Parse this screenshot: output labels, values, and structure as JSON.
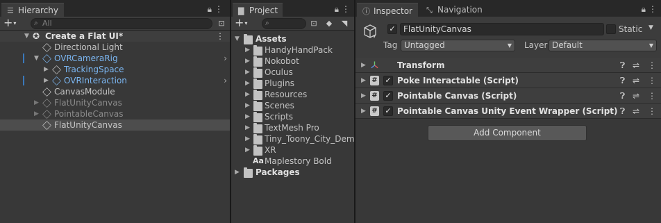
{
  "hierarchy": {
    "tab_label": "Hierarchy",
    "search_placeholder": "All",
    "scene_name": "Create a Flat UI*",
    "items": [
      {
        "label": "Directional Light"
      },
      {
        "label": "OVRCameraRig"
      },
      {
        "label": "TrackingSpace"
      },
      {
        "label": "OVRInteraction"
      },
      {
        "label": "CanvasModule"
      },
      {
        "label": "FlatUnityCanvas"
      },
      {
        "label": "PointableCanvas"
      },
      {
        "label": "FlatUnityCanvas"
      }
    ]
  },
  "project": {
    "tab_label": "Project",
    "root": "Assets",
    "folders": [
      {
        "label": "HandyHandPack"
      },
      {
        "label": "Nokobot"
      },
      {
        "label": "Oculus"
      },
      {
        "label": "Plugins"
      },
      {
        "label": "Resources"
      },
      {
        "label": "Scenes"
      },
      {
        "label": "Scripts"
      },
      {
        "label": "TextMesh Pro"
      },
      {
        "label": "Tiny_Toony_City_Demo"
      },
      {
        "label": "XR"
      }
    ],
    "font_asset": {
      "prefix": "Aa",
      "label": "Maplestory Bold"
    },
    "packages": "Packages"
  },
  "inspector": {
    "tab_label": "Inspector",
    "nav_tab_label": "Navigation",
    "object_name": "FlatUnityCanvas",
    "static_label": "Static",
    "tag_label": "Tag",
    "tag_value": "Untagged",
    "layer_label": "Layer",
    "layer_value": "Default",
    "components": [
      {
        "name": "Transform"
      },
      {
        "name": "Poke Interactable (Script)"
      },
      {
        "name": "Pointable Canvas (Script)"
      },
      {
        "name": "Pointable Canvas Unity Event Wrapper (Script)"
      }
    ],
    "add_component_label": "Add Component"
  },
  "colors": {
    "background": "#383838",
    "selection": "#4d4d4d",
    "prefab_blue": "#7bb6f1",
    "accent_bar": "#3a79bb"
  },
  "icons": [
    "lock-icon",
    "kebab-icon",
    "search-icon",
    "folder-icon",
    "cube-icon",
    "script-icon",
    "transform-icon",
    "help-icon",
    "settings-sliders-icon"
  ]
}
